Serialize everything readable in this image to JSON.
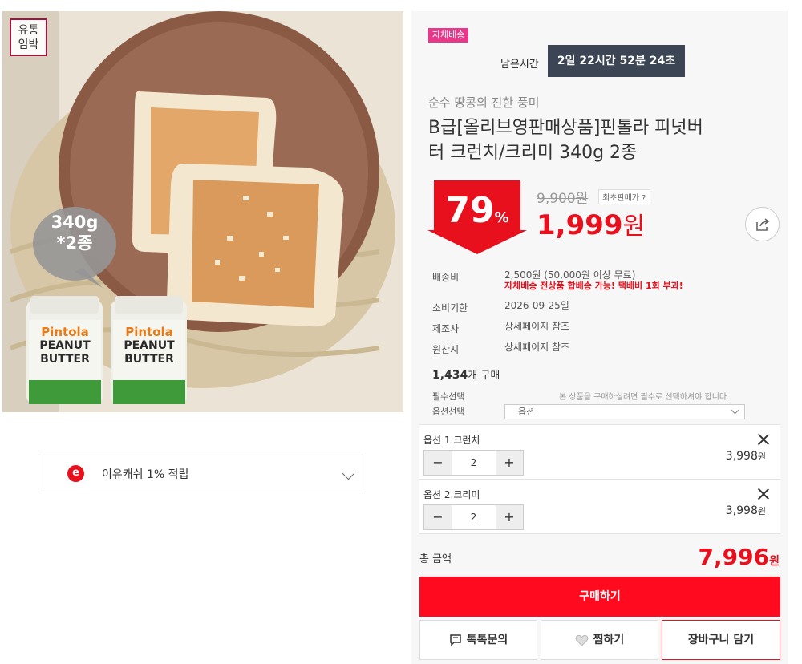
{
  "image": {
    "badge": "유통\n임박",
    "badge_line1": "유통",
    "badge_line2": "임박",
    "bubble_line1": "340g",
    "bubble_line2": "*2종",
    "jar_brand": "Pintola",
    "jar_line1": "PEANUT",
    "jar_line2": "BUTTER"
  },
  "cashback": {
    "icon": "e",
    "label": "이유캐쉬 1% 적립"
  },
  "shipping_badge": "자체배송",
  "timer": {
    "label": "남은시간",
    "value": "2일 22시간 52분 24초"
  },
  "subtitle": "순수 땅콩의 진한 풍미",
  "title": "B급[올리브영판매상품]핀톨라 피넛버터 크런치/크리미 340g 2종",
  "title_line1": "B급[올리브영판매상품]핀톨라 피넛버",
  "title_line2": "터 크런치/크리미 340g 2종",
  "discount": {
    "value": "79",
    "unit": "%"
  },
  "original_price": "9,900원",
  "lowest_price_label": "최초판매가 ?",
  "price": {
    "value": "1,999",
    "unit": "원"
  },
  "details": [
    {
      "label": "배송비",
      "value": "2,500원 (50,000원 이상 무료)",
      "note": "자체배송 전상품 합배송 가능! 택배비 1회 부과!"
    },
    {
      "label": "소비기한",
      "value": "2026-09-25일"
    },
    {
      "label": "제조사",
      "value": "상세페이지 참조"
    },
    {
      "label": "원산지",
      "value": "상세페이지 참조"
    }
  ],
  "purchase_count": "1,434",
  "purchase_suffix": "개 구매",
  "options": {
    "required_label": "필수선택",
    "select_label": "옵션선택",
    "notice": "본 상품을 구매하실려면 필수로 선택하셔야 합니다.",
    "select_value": "옵션"
  },
  "items": [
    {
      "name": "옵션 1.크런치",
      "qty": "2",
      "price": "3,998",
      "unit": "원"
    },
    {
      "name": "옵션 2.크리미",
      "qty": "2",
      "price": "3,998",
      "unit": "원"
    }
  ],
  "stepper": {
    "minus": "−",
    "plus": "+"
  },
  "total": {
    "label": "총 금액",
    "value": "7,996",
    "unit": "원"
  },
  "buttons": {
    "buy": "구매하기",
    "inquiry": "톡톡문의",
    "wish": "찜하기",
    "cart": "장바구니 담기"
  },
  "colors": {
    "accent": "#e8101d",
    "buy": "#ff0a1f",
    "badge": "#e8388a",
    "timer_bg": "#3c4553"
  }
}
